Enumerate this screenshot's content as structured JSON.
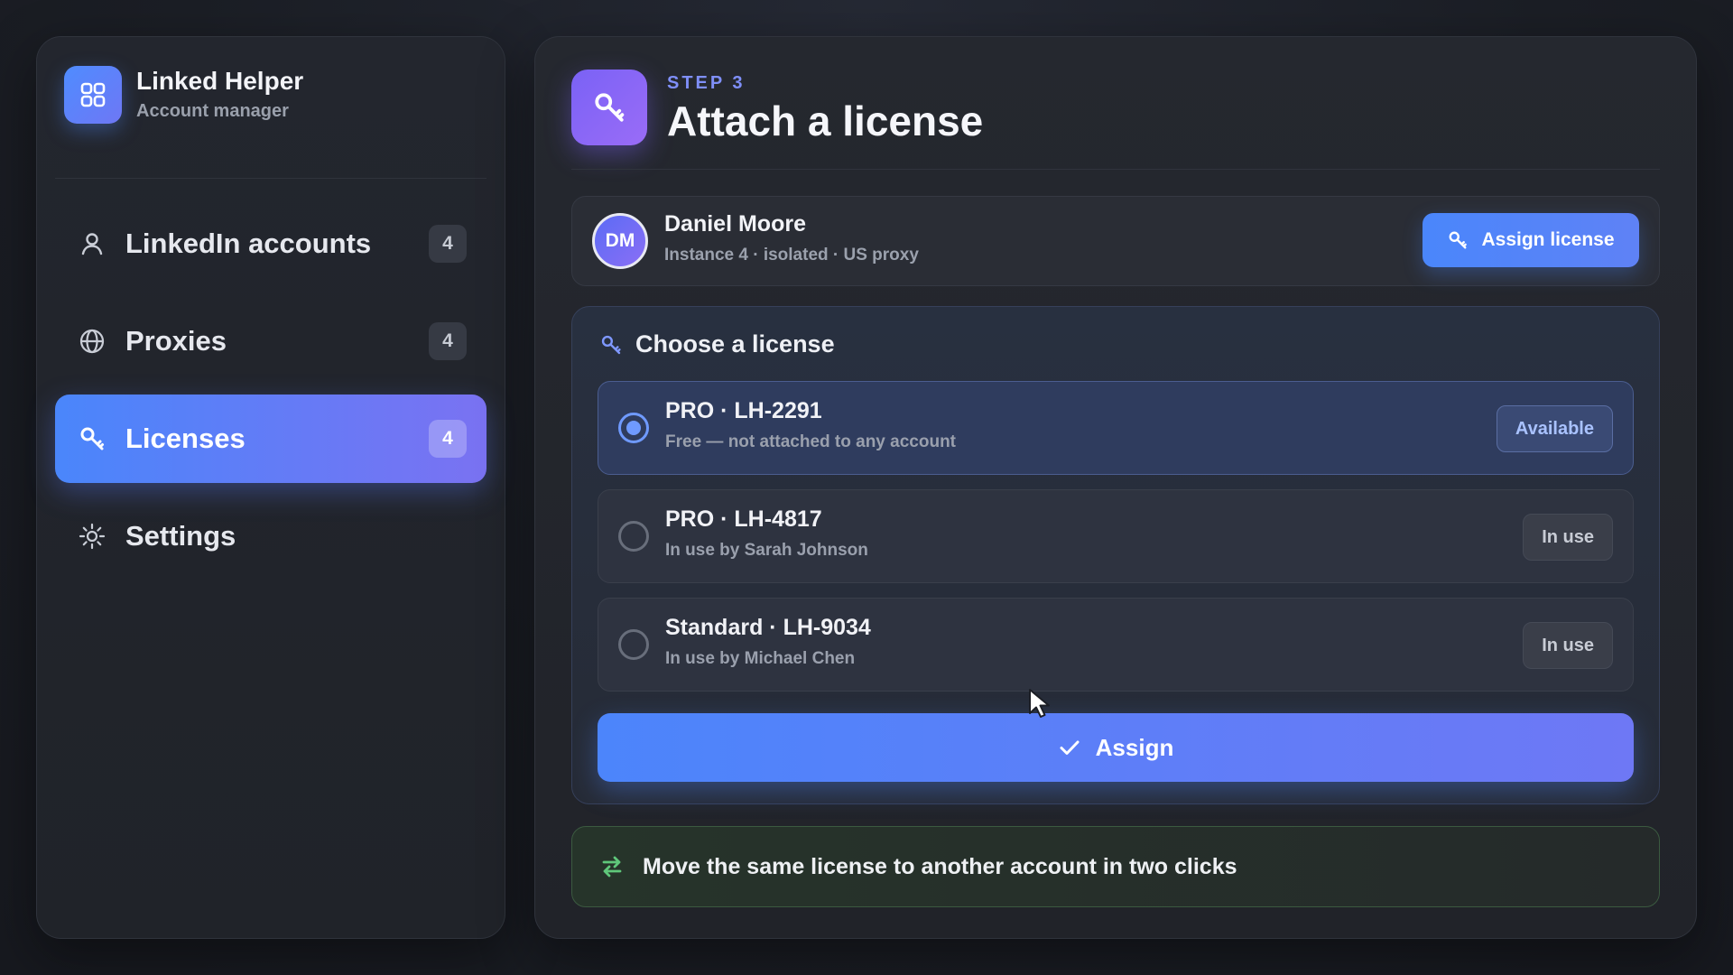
{
  "brand": {
    "title": "Linked Helper",
    "subtitle": "Account manager",
    "icon": "grid-icon"
  },
  "sidebar": {
    "items": [
      {
        "label": "LinkedIn accounts",
        "badge": "4",
        "icon": "user-icon",
        "active": false
      },
      {
        "label": "Proxies",
        "badge": "4",
        "icon": "globe-icon",
        "active": false
      },
      {
        "label": "Licenses",
        "badge": "4",
        "icon": "key-icon",
        "active": true
      },
      {
        "label": "Settings",
        "badge": "",
        "icon": "gear-icon",
        "active": false
      }
    ]
  },
  "header": {
    "step": "STEP 3",
    "title": "Attach a license",
    "icon": "key-icon"
  },
  "account": {
    "initials": "DM",
    "name": "Daniel Moore",
    "meta": "Instance 4 · isolated · US proxy",
    "button": "Assign license"
  },
  "chooser": {
    "title": "Choose a license",
    "licenses": [
      {
        "name": "PRO · LH-2291",
        "desc": "Free — not attached to any account",
        "status": "Available",
        "selected": true
      },
      {
        "name": "PRO · LH-4817",
        "desc": "In use by Sarah Johnson",
        "status": "In use",
        "selected": false
      },
      {
        "name": "Standard · LH-9034",
        "desc": "In use by Michael Chen",
        "status": "In use",
        "selected": false
      }
    ],
    "assign_button": "Assign"
  },
  "tip": {
    "text": "Move the same license to another account in two clicks",
    "icon": "swap-arrows-icon"
  },
  "colors": {
    "accent": "#4a86fb",
    "accent_purple": "#7a62f5",
    "tip_green": "#5fc77a"
  }
}
